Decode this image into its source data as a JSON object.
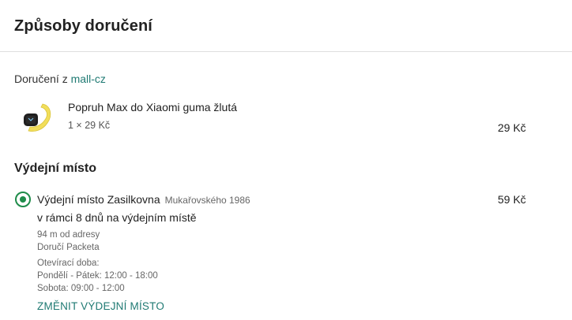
{
  "page_title": "Způsoby doručení",
  "seller": {
    "prefix": "Doručení z",
    "name": "mall-cz"
  },
  "product": {
    "name": "Popruh Max do Xiaomi guma žlutá",
    "qty_price": "1 × 29 Kč",
    "total": "29 Kč",
    "image_icon": "yellow-watch-strap",
    "strap_color": "#f2de5a"
  },
  "pickup_section": {
    "title": "Výdejní místo",
    "option": {
      "name": "Výdejní místo Zasilkovna",
      "address": "Mukařovského 1986",
      "price": "59 Kč",
      "eta": "v rámci 8 dnů na výdejním místě",
      "distance": "94 m od adresy",
      "carrier": "Doručí Packeta",
      "hours_label": "Otevírací doba:",
      "hours_weekday": "Pondělí - Pátek: 12:00 - 18:00",
      "hours_saturday": "Sobota: 09:00 - 12:00",
      "selected": true
    },
    "change_label": "ZMĚNIT VÝDEJNÍ MÍSTO"
  },
  "colors": {
    "accent": "#1f7a73",
    "radio": "#1f8c4a",
    "divider": "#dedede"
  }
}
